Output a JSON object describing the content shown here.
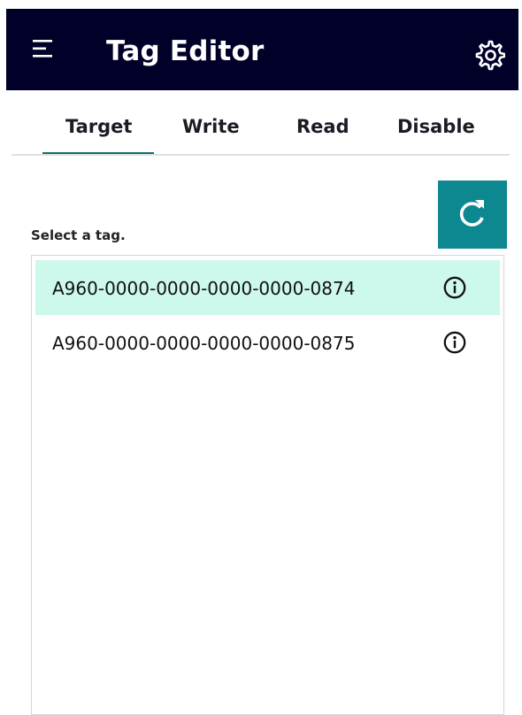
{
  "header": {
    "title": "Tag Editor",
    "menu_icon": "hamburger-menu-icon",
    "settings_icon": "gear-icon",
    "background": "#000028"
  },
  "tabs": [
    {
      "label": "Target",
      "active": true
    },
    {
      "label": "Write",
      "active": false
    },
    {
      "label": "Read",
      "active": false
    },
    {
      "label": "Disable",
      "active": false
    }
  ],
  "accent_color": "#0b6e73",
  "refresh_button": {
    "icon": "refresh-icon",
    "color": "#0d8790"
  },
  "select_label": "Select a tag.",
  "tag_list": {
    "items": [
      {
        "id": "A960-0000-0000-0000-0000-0874",
        "selected": true,
        "icon": "info-icon"
      },
      {
        "id": "A960-0000-0000-0000-0000-0875",
        "selected": false,
        "icon": "info-icon"
      }
    ],
    "selected_color": "#cdf8ec"
  }
}
